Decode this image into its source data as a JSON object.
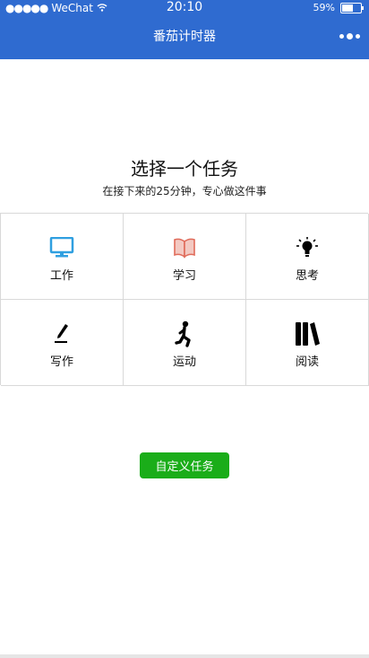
{
  "status_bar": {
    "carrier": "WeChat",
    "signal": "●●●●●",
    "time": "20:10",
    "battery_text": "59%",
    "battery_level": 0.59
  },
  "nav": {
    "title": "番茄计时器"
  },
  "main": {
    "headline": "选择一个任务",
    "subline": "在接下来的25分钟，专心做这件事"
  },
  "tasks": [
    {
      "label": "工作",
      "icon": "monitor-icon",
      "color": "#2f9fe0"
    },
    {
      "label": "学习",
      "icon": "book-icon",
      "color": "#e06b5a"
    },
    {
      "label": "思考",
      "icon": "lightbulb-icon",
      "color": "#000000"
    },
    {
      "label": "写作",
      "icon": "pen-icon",
      "color": "#000000"
    },
    {
      "label": "运动",
      "icon": "running-icon",
      "color": "#000000"
    },
    {
      "label": "阅读",
      "icon": "books-icon",
      "color": "#000000"
    }
  ],
  "actions": {
    "custom_label": "自定义任务"
  },
  "colors": {
    "accent": "#2f6bd0",
    "button": "#1aad19"
  }
}
